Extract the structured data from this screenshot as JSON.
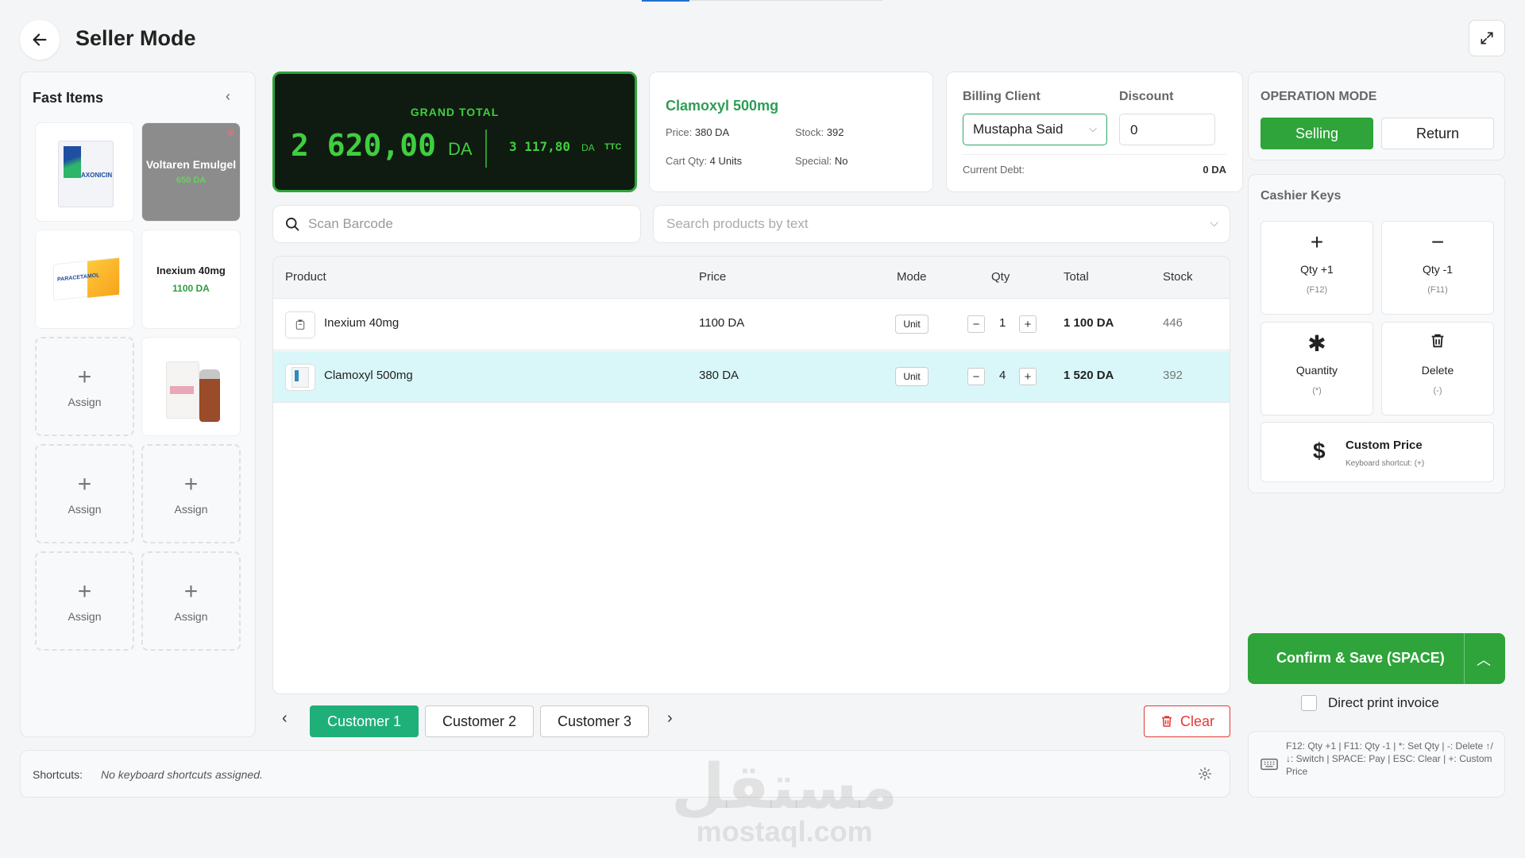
{
  "header": {
    "title": "Seller Mode"
  },
  "fast_items": {
    "title": "Fast Items",
    "tiles": [
      {
        "label": "",
        "price": ""
      },
      {
        "label": "Voltaren Emulgel",
        "price": "650 DA"
      },
      {
        "label": "",
        "price": ""
      },
      {
        "label": "Inexium 40mg",
        "price": "1100 DA"
      },
      {
        "label": "Assign"
      },
      {
        "label": ""
      },
      {
        "label": "Assign"
      },
      {
        "label": "Assign"
      },
      {
        "label": "Assign"
      },
      {
        "label": "Assign"
      }
    ]
  },
  "grand_total": {
    "label": "GRAND TOTAL",
    "amount": "2 620,00",
    "currency": "DA",
    "ttc_amount": "3 117,80",
    "ttc_currency": "DA",
    "ttc_tag": "TTC"
  },
  "product_info": {
    "name": "Clamoxyl 500mg",
    "price_label": "Price:",
    "price_value": "380 DA",
    "stock_label": "Stock:",
    "stock_value": "392",
    "cart_label": "Cart Qty:",
    "cart_value": "4 Units",
    "special_label": "Special:",
    "special_value": "No"
  },
  "billing": {
    "client_label": "Billing Client",
    "client_value": "Mustapha Said",
    "discount_label": "Discount",
    "discount_value": "0",
    "debt_label": "Current Debt:",
    "debt_value": "0 DA"
  },
  "operation": {
    "title": "OPERATION MODE",
    "selling": "Selling",
    "return": "Return"
  },
  "cashier_keys": {
    "title": "Cashier Keys",
    "keys": [
      {
        "icon": "+",
        "label": "Qty +1",
        "shortcut": "(F12)"
      },
      {
        "icon": "−",
        "label": "Qty -1",
        "shortcut": "(F11)"
      },
      {
        "icon": "✱",
        "label": "Quantity",
        "shortcut": "(*)"
      },
      {
        "icon": "🗑",
        "label": "Delete",
        "shortcut": "(-)"
      }
    ],
    "custom_price": {
      "icon": "$",
      "label": "Custom Price",
      "shortcut": "Keyboard shortcut: (+)"
    }
  },
  "search": {
    "barcode_placeholder": "Scan Barcode",
    "text_placeholder": "Search products by text"
  },
  "table": {
    "columns": [
      "Product",
      "Price",
      "Mode",
      "Qty",
      "Total",
      "Stock"
    ],
    "rows": [
      {
        "product": "Inexium 40mg",
        "price": "1100 DA",
        "mode": "Unit",
        "qty": "1",
        "total": "1 100 DA",
        "stock": "446"
      },
      {
        "product": "Clamoxyl 500mg",
        "price": "380 DA",
        "mode": "Unit",
        "qty": "4",
        "total": "1 520 DA",
        "stock": "392"
      }
    ]
  },
  "customers": [
    "Customer 1",
    "Customer 2",
    "Customer 3"
  ],
  "clear_label": "Clear",
  "confirm_label": "Confirm & Save (SPACE)",
  "print_label": "Direct print invoice",
  "shortcut_help": "F12: Qty +1 | F11: Qty -1 | *: Set Qty | -: Delete ↑/↓: Switch | SPACE: Pay | ESC: Clear | +: Custom Price",
  "shortcuts_bar": {
    "label": "Shortcuts:",
    "value": "No keyboard shortcuts assigned."
  },
  "watermark": {
    "arabic": "مستقل",
    "latin": "mostaql.com"
  },
  "colors": {
    "accent_green": "#2ea43a",
    "teal": "#1fb07a",
    "danger": "#e53935",
    "selected_row": "#d9f7f8"
  }
}
